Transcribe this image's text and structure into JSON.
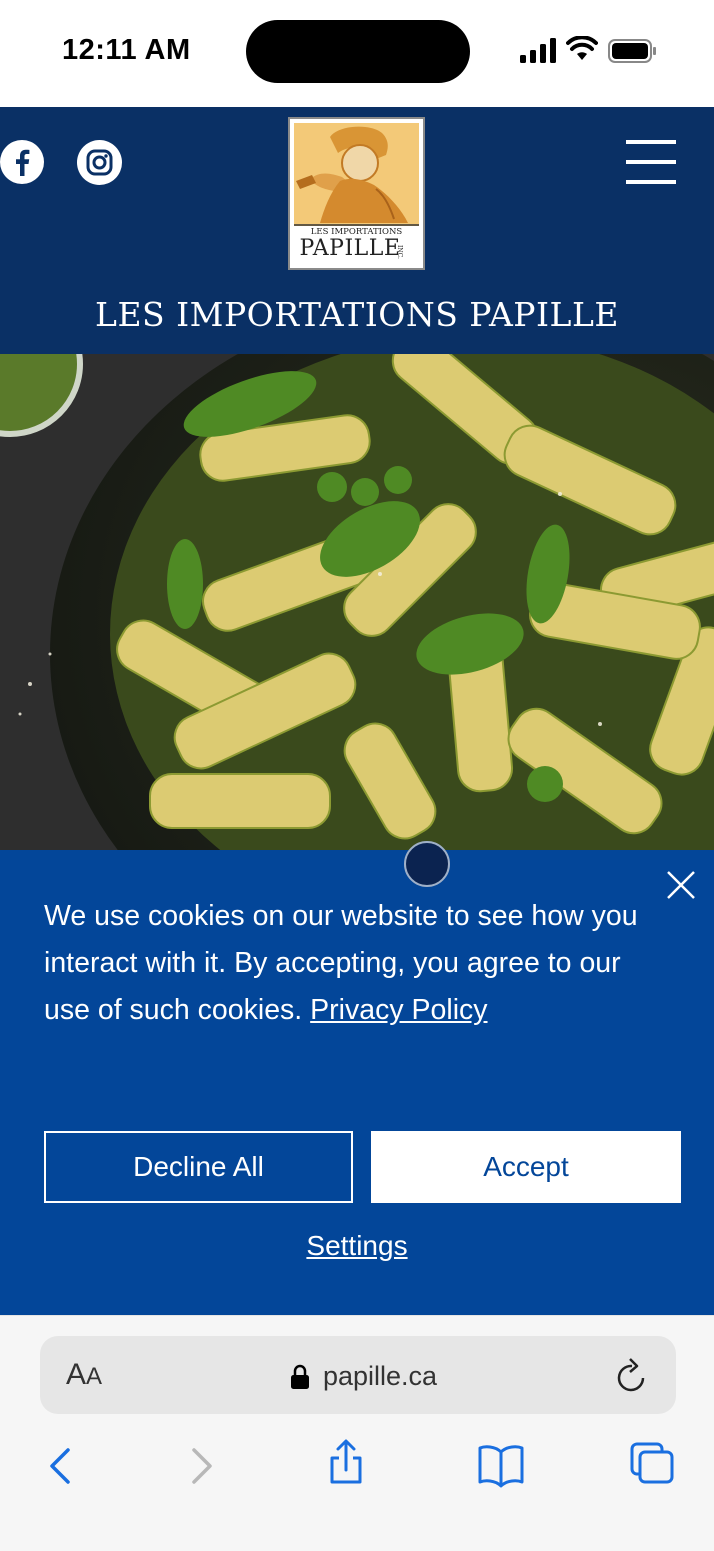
{
  "status_bar": {
    "time": "12:11 AM"
  },
  "header": {
    "logo_line1": "LES IMPORTATIONS",
    "logo_line2": "PAPILLE",
    "logo_suffix": "INC.",
    "site_title": "LES IMPORTATIONS PAPILLE"
  },
  "cookie_banner": {
    "message": "We use cookies on our website to see how you interact with it. By accepting, you agree to our use of such cookies. ",
    "privacy_link": "Privacy Policy",
    "decline_label": "Decline All",
    "accept_label": "Accept",
    "settings_label": "Settings"
  },
  "browser": {
    "text_size_big": "A",
    "text_size_small": "A",
    "url": "papille.ca"
  },
  "icons": [
    "facebook-icon",
    "instagram-icon",
    "menu-icon",
    "close-icon",
    "lock-icon",
    "reload-icon",
    "back-icon",
    "forward-icon",
    "share-icon",
    "bookmarks-icon",
    "tabs-icon"
  ],
  "colors": {
    "header": "#0a3065",
    "cookie_banner": "#034699",
    "accent_link": "#1a6fe0"
  }
}
